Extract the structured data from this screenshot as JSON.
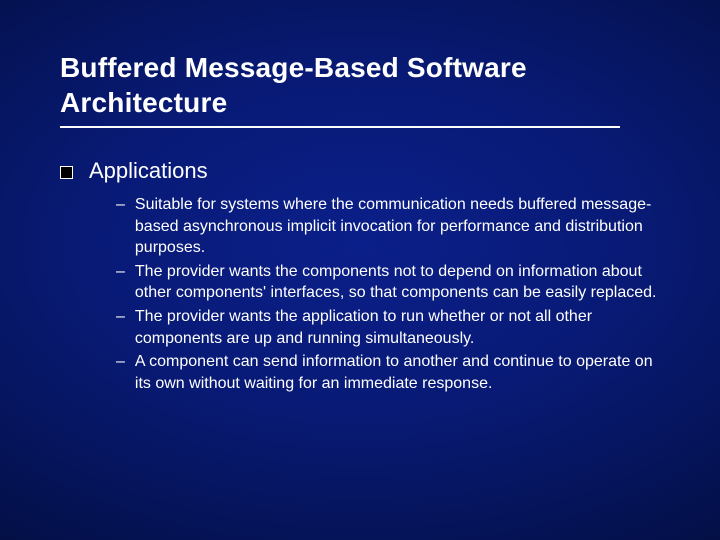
{
  "title": "Buffered Message-Based Software Architecture",
  "section": "Applications",
  "bullets": [
    "Suitable for systems where the communication needs buffered message-based asynchronous implicit invocation for performance and distribution purposes.",
    "The provider wants the components not to depend on information about other components' interfaces, so that components can be easily replaced.",
    "The provider wants the application to run whether or not all other components are up and running simultaneously.",
    "A component can send information to another and continue to operate on its own without waiting for an immediate response."
  ]
}
